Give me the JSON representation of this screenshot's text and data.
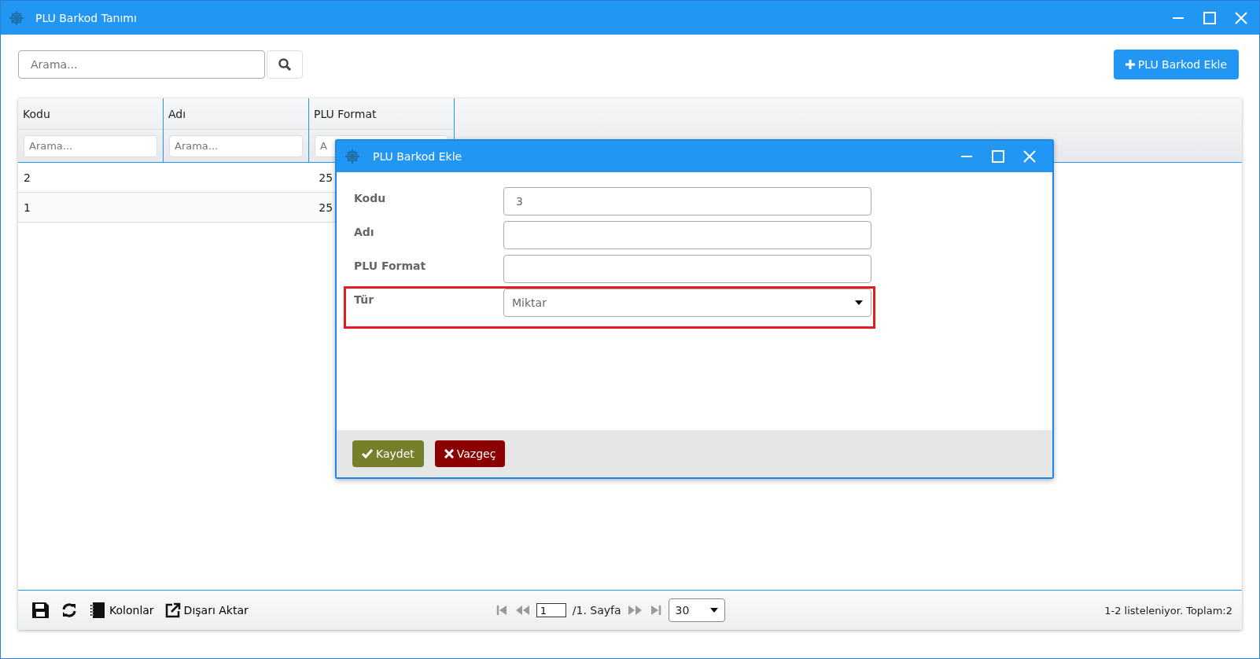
{
  "window": {
    "title": "PLU Barkod Tanımı"
  },
  "search": {
    "placeholder": "Arama..."
  },
  "add_button": {
    "label": "PLU Barkod Ekle"
  },
  "table": {
    "columns": [
      {
        "label": "Kodu",
        "filter_placeholder": "Arama..."
      },
      {
        "label": "Adı",
        "filter_placeholder": "Arama..."
      },
      {
        "label": "PLU Format",
        "filter_placeholder": "A"
      }
    ],
    "rows": [
      [
        "2",
        "",
        "25"
      ],
      [
        "1",
        "",
        "25"
      ]
    ]
  },
  "footer": {
    "tools": [
      {
        "kind": "save"
      },
      {
        "kind": "refresh"
      },
      {
        "kind": "columns",
        "label": "Kolonlar"
      },
      {
        "kind": "export",
        "label": "Dışarı Aktar"
      }
    ],
    "page_input": "1",
    "page_label": "/1. Sayfa",
    "page_size": "30",
    "summary": "1-2 listeleniyor. Toplam:2"
  },
  "dialog": {
    "title": "PLU Barkod Ekle",
    "fields": [
      {
        "label": "Kodu",
        "kind": "text",
        "value": "3",
        "highlighted": false
      },
      {
        "label": "Adı",
        "kind": "text",
        "highlighted": false
      },
      {
        "label": "PLU Format",
        "kind": "text",
        "highlighted": false
      },
      {
        "label": "Tür",
        "kind": "select",
        "value": "Miktar",
        "highlighted": true
      }
    ],
    "buttons": [
      {
        "label": "Kaydet",
        "kind": "save"
      },
      {
        "label": "Vazgeç",
        "kind": "cancel"
      }
    ]
  }
}
